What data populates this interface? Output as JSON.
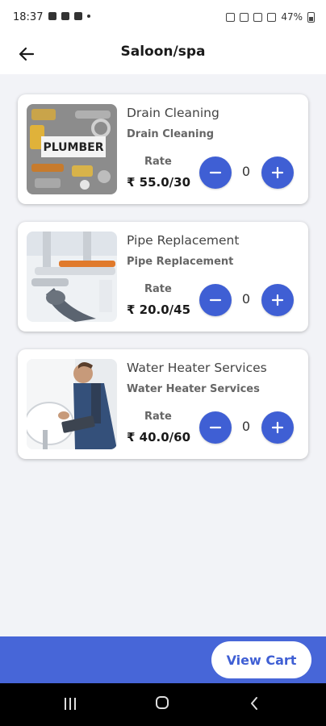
{
  "status_bar": {
    "time": "18:37",
    "battery": "47%"
  },
  "header": {
    "title": "Saloon/spa",
    "back_icon": "arrow-left-icon"
  },
  "services": [
    {
      "name": "Drain Cleaning",
      "subtitle": "Drain Cleaning",
      "rate_label": "Rate",
      "rate": "₹ 55.0/30",
      "quantity": "0",
      "image": "plumber-tools-image"
    },
    {
      "name": "Pipe Replacement",
      "subtitle": "Pipe Replacement",
      "rate_label": "Rate",
      "rate": "₹ 20.0/45",
      "quantity": "0",
      "image": "pipe-wrench-image"
    },
    {
      "name": "Water Heater Services",
      "subtitle": "Water Heater Services",
      "rate_label": "Rate",
      "rate": "₹ 40.0/60",
      "quantity": "0",
      "image": "water-heater-technician-image"
    }
  ],
  "actions": {
    "view_cart": "View Cart"
  },
  "colors": {
    "accent": "#3f5fd4",
    "bottom_bar": "#4766d8",
    "background": "#f2f3f7"
  }
}
